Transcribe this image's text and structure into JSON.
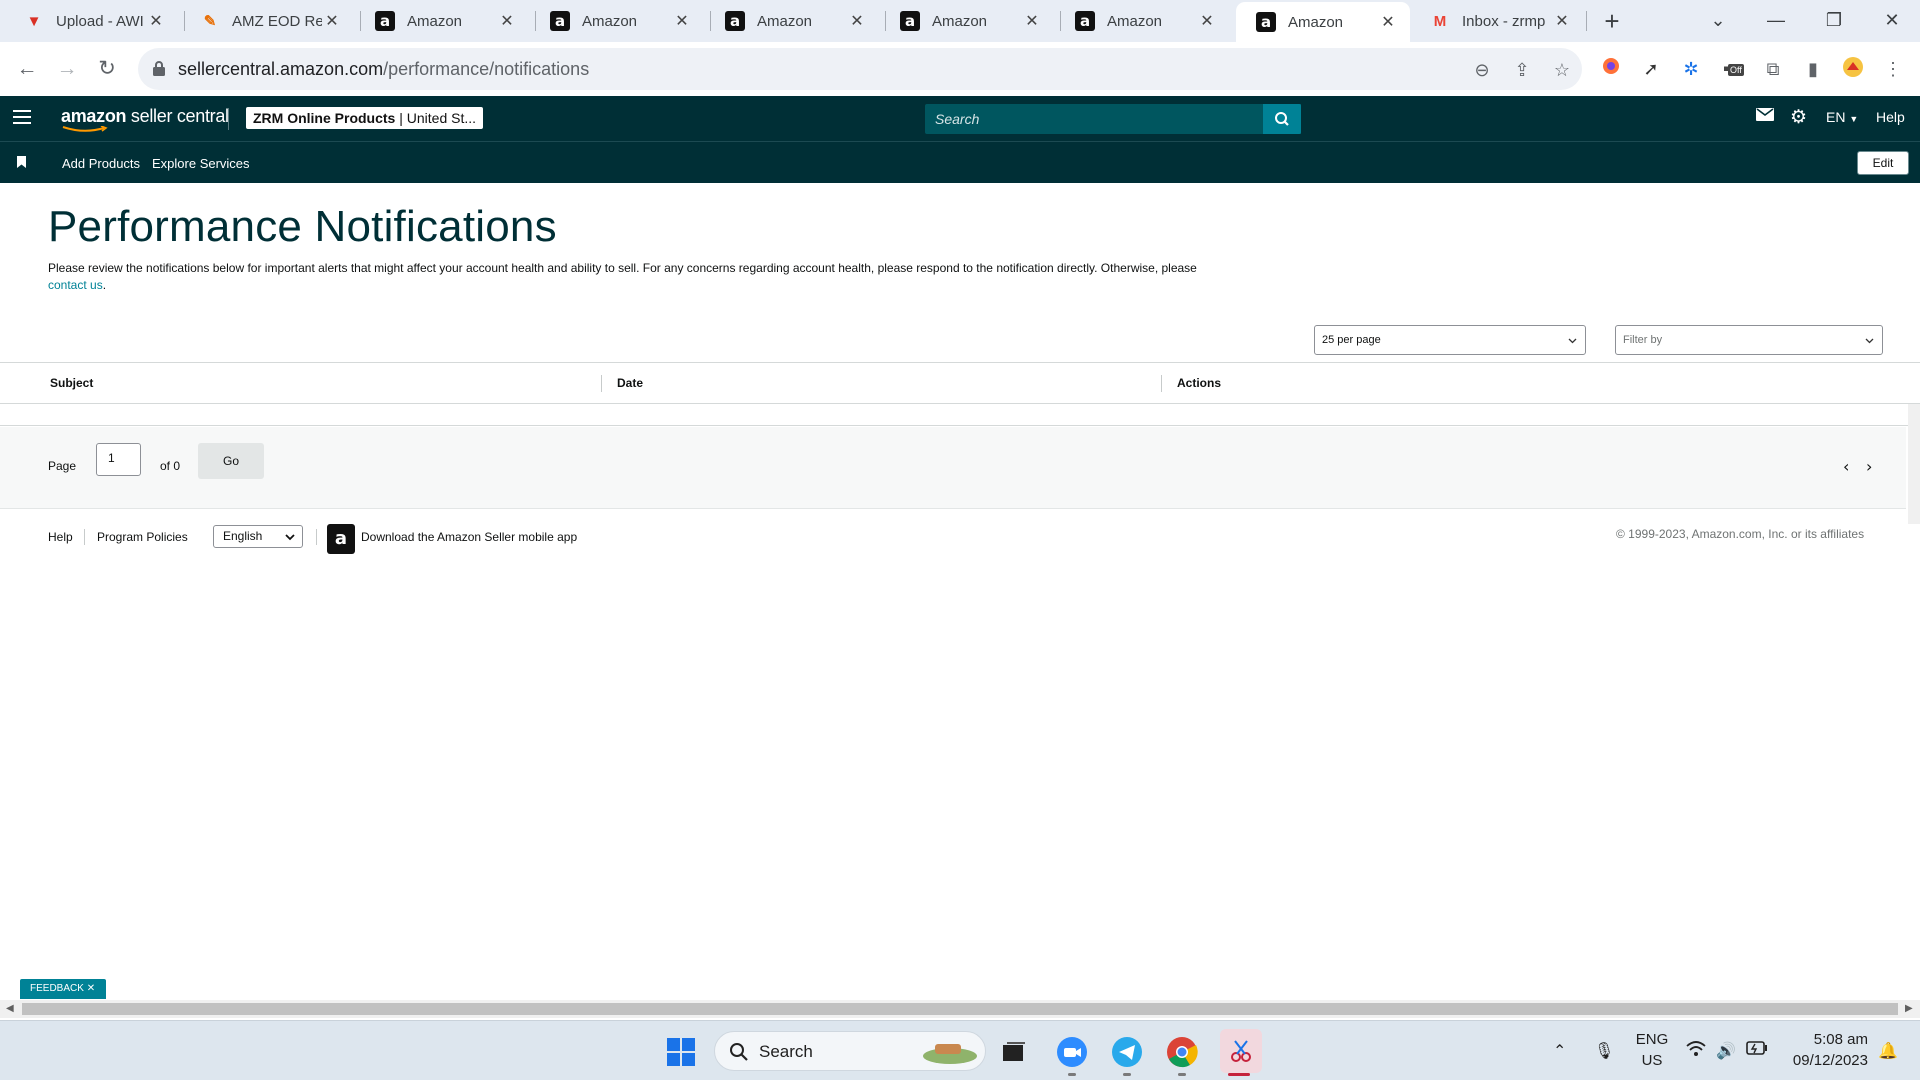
{
  "browser": {
    "tabs": [
      {
        "title": "Upload - AWI",
        "favicon": "v-logo-icon"
      },
      {
        "title": "AMZ EOD Rep",
        "favicon": "ribbon-icon"
      },
      {
        "title": "Amazon",
        "favicon": "amazon-a-icon"
      },
      {
        "title": "Amazon",
        "favicon": "amazon-a-icon"
      },
      {
        "title": "Amazon",
        "favicon": "amazon-a-icon"
      },
      {
        "title": "Amazon",
        "favicon": "amazon-a-icon"
      },
      {
        "title": "Amazon",
        "favicon": "amazon-a-icon"
      },
      {
        "title": "Amazon",
        "favicon": "amazon-a-icon",
        "active": true
      },
      {
        "title": "Inbox - zrmp",
        "favicon": "gmail-icon"
      }
    ],
    "url_host": "sellercentral.amazon.com",
    "url_path": "/performance/notifications",
    "extension_badge": "Off"
  },
  "header": {
    "logo_part1": "amazon",
    "logo_part2": " seller central",
    "account_name": "ZRM Online Products",
    "account_region": "United St...",
    "search_placeholder": "Search",
    "language": "EN",
    "help_label": "Help"
  },
  "nav": {
    "links": [
      "Add Products",
      "Explore Services"
    ],
    "edit_label": "Edit"
  },
  "page": {
    "title": "Performance Notifications",
    "intro": "Please review the notifications below for important alerts that might affect your account health and ability to sell. For any concerns regarding account health, please respond to the notification directly. Otherwise, please",
    "intro_link": "contact us",
    "per_page": "25 per page",
    "filter_placeholder": "Filter by",
    "columns": [
      "Subject",
      "Date",
      "Actions"
    ],
    "pager": {
      "page_label": "Page",
      "page_value": "1",
      "of_label": "of 0",
      "go_label": "Go"
    }
  },
  "footer": {
    "links": [
      "Help",
      "Program Policies"
    ],
    "language": "English",
    "app_text": "Download the Amazon Seller mobile app",
    "copyright": "© 1999-2023, Amazon.com, Inc. or its affiliates"
  },
  "feedback_label": "FEEDBACK",
  "taskbar": {
    "search_label": "Search",
    "lang_line1": "ENG",
    "lang_line2": "US",
    "time": "5:08 am",
    "date": "09/12/2023"
  },
  "colors": {
    "header_bg": "#002f36",
    "accent": "#008296",
    "title": "#002f36"
  }
}
